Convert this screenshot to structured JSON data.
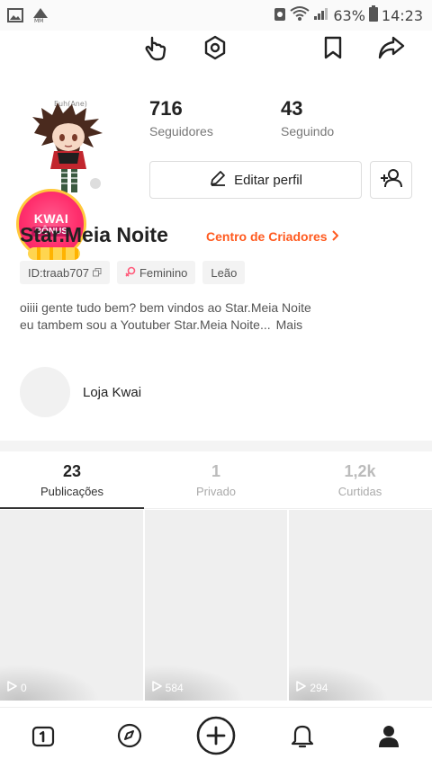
{
  "status": {
    "battery": "63%",
    "time": "14:23"
  },
  "profile": {
    "followers_count": "716",
    "followers_label": "Seguidores",
    "following_count": "43",
    "following_label": "Seguindo",
    "edit_label": "Editar perfil",
    "name": "Star.Meia Noite",
    "creator_center": "Centro de Criadores",
    "bonus_line1": "KWAI",
    "bonus_line2": "BÔNUS",
    "tags": {
      "id": "ID:traab707",
      "gender": "Feminino",
      "sign": "Leão"
    },
    "bio_line1": "oiiii gente tudo bem? bem vindos ao Star.Meia Noite",
    "bio_line2": "eu tambem sou a Youtuber Star.Meia Noite...",
    "more_label": "Mais",
    "shop_label": "Loja Kwai"
  },
  "tabs": [
    {
      "count": "23",
      "label": "Publicações"
    },
    {
      "count": "1",
      "label": "Privado"
    },
    {
      "count": "1,2k",
      "label": "Curtidas"
    }
  ],
  "videos": [
    {
      "views": "0"
    },
    {
      "views": "584"
    },
    {
      "views": "294"
    }
  ],
  "colors": {
    "accent": "#ff5a1f",
    "bonus": "#ff2f6d"
  }
}
